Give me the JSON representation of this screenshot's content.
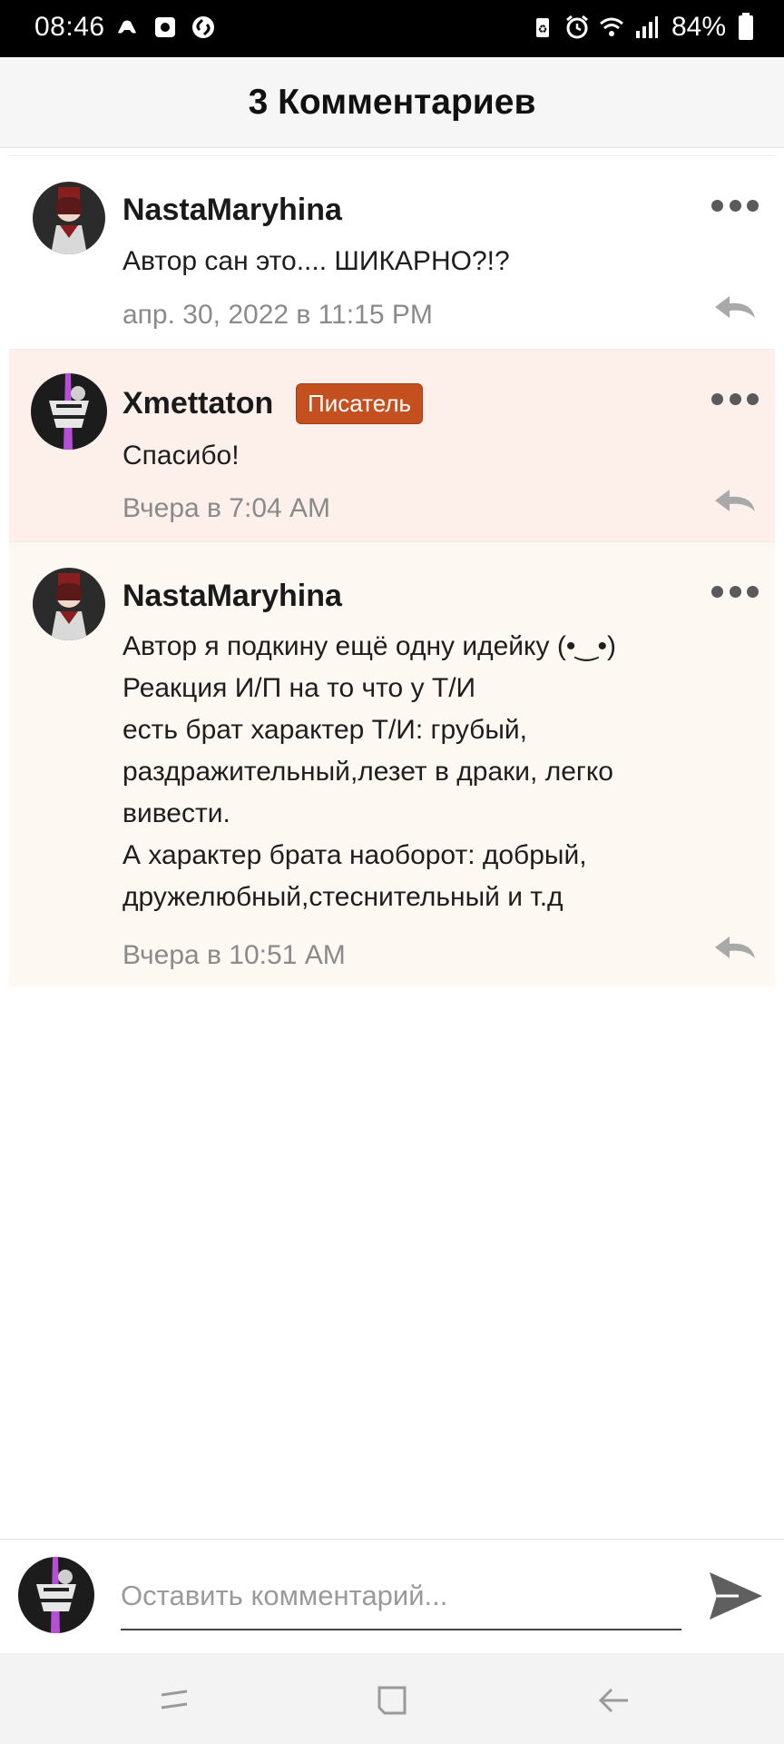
{
  "status_bar": {
    "time": "08:46",
    "battery": "84%"
  },
  "header": {
    "title": "3 Комментариев"
  },
  "comments": [
    {
      "username": "NastaMaryhina",
      "badge": "",
      "text": "Автор сан это.... ШИКАРНО?!?",
      "time": "апр. 30, 2022 в 11:15 PM",
      "background": "#ffffff"
    },
    {
      "username": "Xmettaton",
      "badge": "Писатель",
      "text": "Спасибо!",
      "time": "Вчера в 7:04 AM",
      "background": "#fdf0ea"
    },
    {
      "username": "NastaMaryhina",
      "badge": "",
      "text": "Автор я подкину ещё одну идейку (•‿•)\nРеакция И/П на то что у Т/И\nесть брат характер Т/И: грубый,\nраздражительный,лезет в драки, легко\nвивести.\nА характер брата наоборот: добрый,\nдружелюбный,стеснительный и т.д",
      "time": "Вчера в 10:51 AM",
      "background": "#fef8f3"
    }
  ],
  "input": {
    "placeholder": "Оставить комментарий..."
  },
  "colors": {
    "badge": "#c44f1f",
    "header_bg": "#f6f6f6",
    "highlight_bg": "#fdf0ea"
  },
  "icons": {
    "more": "more-dots-icon",
    "reply": "reply-arrow-icon",
    "send": "send-icon"
  }
}
